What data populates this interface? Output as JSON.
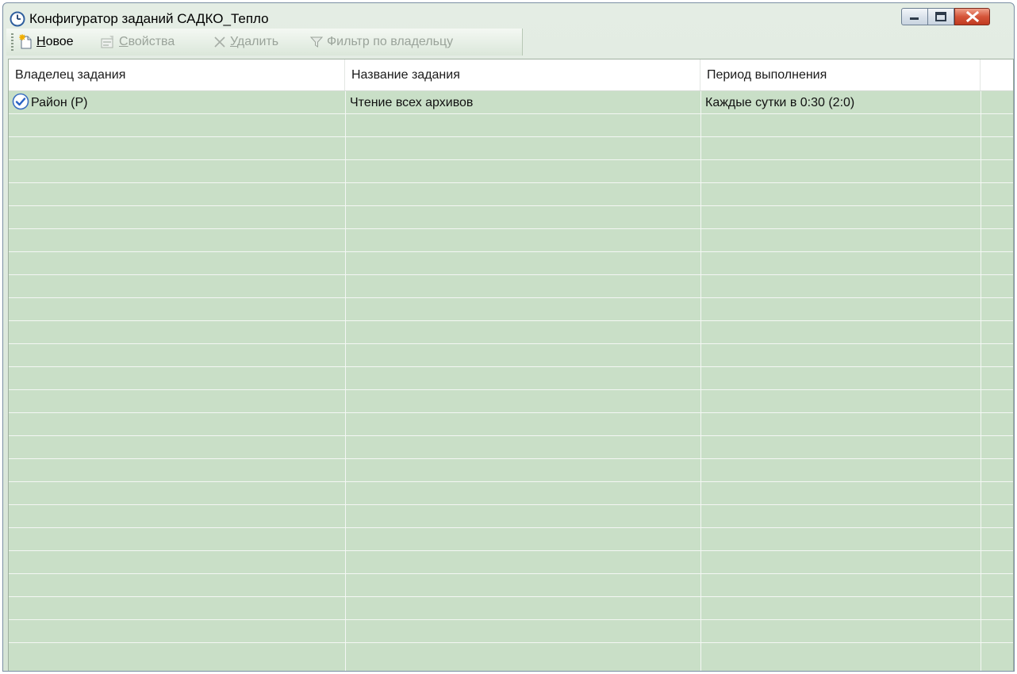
{
  "window": {
    "title": "Конфигуратор заданий САДКО_Тепло"
  },
  "toolbar": {
    "new": {
      "prefix": "",
      "accel": "Н",
      "rest": "овое"
    },
    "properties": {
      "prefix": "",
      "accel": "С",
      "rest": "войства"
    },
    "delete": {
      "prefix": "",
      "accel": "У",
      "rest": "далить"
    },
    "filter": {
      "label": "Фильтр по владельцу"
    }
  },
  "list": {
    "columns": [
      "Владелец задания",
      "Название задания",
      "Период выполнения",
      ""
    ],
    "rows": [
      {
        "owner": "Район (Р)",
        "name": "Чтение всех архивов",
        "period": "Каждые  сутки в 0:30 (2:0)",
        "status": "check-icon"
      }
    ],
    "empty_rows": 23
  },
  "colors": {
    "row_background": "#c9dfc7",
    "header_background": "#ffffff",
    "close_button": "#c8452a"
  }
}
